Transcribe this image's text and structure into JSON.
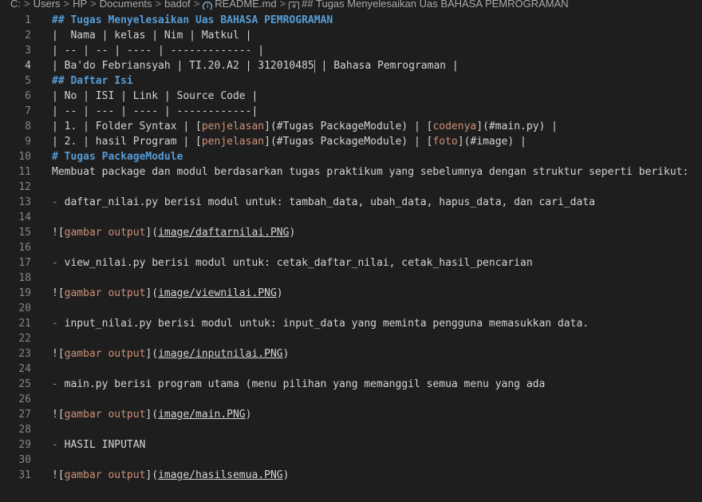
{
  "breadcrumb": {
    "items": [
      "C:",
      "Users",
      "HP",
      "Documents",
      "badof",
      "README.md",
      "## Tugas Menyelesaikan Uas BAHASA PEMROGRAMAN"
    ],
    "separator": ">"
  },
  "editor": {
    "current_line": 4,
    "lines": [
      {
        "n": "1",
        "segs": [
          {
            "c": "h",
            "t": "## Tugas Menyelesaikan Uas BAHASA PEMROGRAMAN"
          }
        ]
      },
      {
        "n": "2",
        "segs": [
          {
            "c": "",
            "t": "|  Nama | kelas | Nim | Matkul |"
          }
        ]
      },
      {
        "n": "3",
        "segs": [
          {
            "c": "",
            "t": "| -- | -- | ---- | ------------- |"
          }
        ]
      },
      {
        "n": "4",
        "segs": [
          {
            "c": "",
            "t": "| Ba'do Febriansyah | TI.20.A2 | 312010485"
          },
          {
            "c": "cursor",
            "t": ""
          },
          {
            "c": "",
            "t": " | Bahasa Pemrograman |"
          }
        ]
      },
      {
        "n": "5",
        "segs": [
          {
            "c": "h",
            "t": "## Daftar Isi"
          }
        ]
      },
      {
        "n": "6",
        "segs": [
          {
            "c": "",
            "t": "| No | ISI | Link | Source Code |"
          }
        ]
      },
      {
        "n": "7",
        "segs": [
          {
            "c": "",
            "t": "| -- | --- | ---- | ------------|"
          }
        ]
      },
      {
        "n": "8",
        "segs": [
          {
            "c": "",
            "t": "| 1. | Folder Syntax | ["
          },
          {
            "c": "lt",
            "t": "penjelasan"
          },
          {
            "c": "",
            "t": "](#Tugas PackageModule) | ["
          },
          {
            "c": "lt",
            "t": "codenya"
          },
          {
            "c": "",
            "t": "](#main.py) |"
          }
        ]
      },
      {
        "n": "9",
        "segs": [
          {
            "c": "",
            "t": "| 2. | hasil Program | ["
          },
          {
            "c": "lt",
            "t": "penjelasan"
          },
          {
            "c": "",
            "t": "](#Tugas PackageModule) | ["
          },
          {
            "c": "lt",
            "t": "foto"
          },
          {
            "c": "",
            "t": "](#image) |"
          }
        ]
      },
      {
        "n": "10",
        "segs": [
          {
            "c": "h",
            "t": "# Tugas PackageModule"
          }
        ]
      },
      {
        "n": "11",
        "segs": [
          {
            "c": "",
            "t": "Membuat package dan modul berdasarkan tugas praktikum yang sebelumnya dengan struktur seperti berikut:"
          }
        ]
      },
      {
        "n": "12",
        "segs": []
      },
      {
        "n": "13",
        "segs": [
          {
            "c": "li",
            "t": "-"
          },
          {
            "c": "",
            "t": " daftar_nilai.py berisi modul untuk: tambah_data, ubah_data, hapus_data, dan cari_data"
          }
        ]
      },
      {
        "n": "14",
        "segs": []
      },
      {
        "n": "15",
        "segs": [
          {
            "c": "",
            "t": "!["
          },
          {
            "c": "lt",
            "t": "gambar output"
          },
          {
            "c": "",
            "t": "]("
          },
          {
            "c": "ul",
            "t": "image/daftarnilai.PNG"
          },
          {
            "c": "",
            "t": ")"
          }
        ]
      },
      {
        "n": "16",
        "segs": []
      },
      {
        "n": "17",
        "segs": [
          {
            "c": "li",
            "t": "-"
          },
          {
            "c": "",
            "t": " view_nilai.py berisi modul untuk: cetak_daftar_nilai, cetak_hasil_pencarian"
          }
        ]
      },
      {
        "n": "18",
        "segs": []
      },
      {
        "n": "19",
        "segs": [
          {
            "c": "",
            "t": "!["
          },
          {
            "c": "lt",
            "t": "gambar output"
          },
          {
            "c": "",
            "t": "]("
          },
          {
            "c": "ul",
            "t": "image/viewnilai.PNG"
          },
          {
            "c": "",
            "t": ")"
          }
        ]
      },
      {
        "n": "20",
        "segs": []
      },
      {
        "n": "21",
        "segs": [
          {
            "c": "li",
            "t": "-"
          },
          {
            "c": "",
            "t": " input_nilai.py berisi modul untuk: input_data yang meminta pengguna memasukkan data."
          }
        ]
      },
      {
        "n": "22",
        "segs": []
      },
      {
        "n": "23",
        "segs": [
          {
            "c": "",
            "t": "!["
          },
          {
            "c": "lt",
            "t": "gambar output"
          },
          {
            "c": "",
            "t": "]("
          },
          {
            "c": "ul",
            "t": "image/inputnilai.PNG"
          },
          {
            "c": "",
            "t": ")"
          }
        ]
      },
      {
        "n": "24",
        "segs": []
      },
      {
        "n": "25",
        "segs": [
          {
            "c": "li",
            "t": "-"
          },
          {
            "c": "",
            "t": " main.py berisi program utama (menu pilihan yang memanggil semua menu yang ada"
          }
        ]
      },
      {
        "n": "26",
        "segs": []
      },
      {
        "n": "27",
        "segs": [
          {
            "c": "",
            "t": "!["
          },
          {
            "c": "lt",
            "t": "gambar output"
          },
          {
            "c": "",
            "t": "]("
          },
          {
            "c": "ul",
            "t": "image/main.PNG"
          },
          {
            "c": "",
            "t": ")"
          }
        ]
      },
      {
        "n": "28",
        "segs": []
      },
      {
        "n": "29",
        "segs": [
          {
            "c": "li",
            "t": "-"
          },
          {
            "c": "",
            "t": " HASIL INPUTAN"
          }
        ]
      },
      {
        "n": "30",
        "segs": []
      },
      {
        "n": "31",
        "segs": [
          {
            "c": "",
            "t": "!["
          },
          {
            "c": "lt",
            "t": "gambar output"
          },
          {
            "c": "",
            "t": "]("
          },
          {
            "c": "ul",
            "t": "image/hasilsemua.PNG"
          },
          {
            "c": "",
            "t": ")"
          }
        ]
      }
    ]
  },
  "colors": {
    "background": "#1e1e1e",
    "text": "#d4d4d4",
    "heading": "#569cd6",
    "link_text": "#ce9178",
    "line_number": "#858585",
    "list_marker": "#6796e6"
  },
  "icons": {
    "readme": "info-icon",
    "symbol": "hash-icon"
  }
}
